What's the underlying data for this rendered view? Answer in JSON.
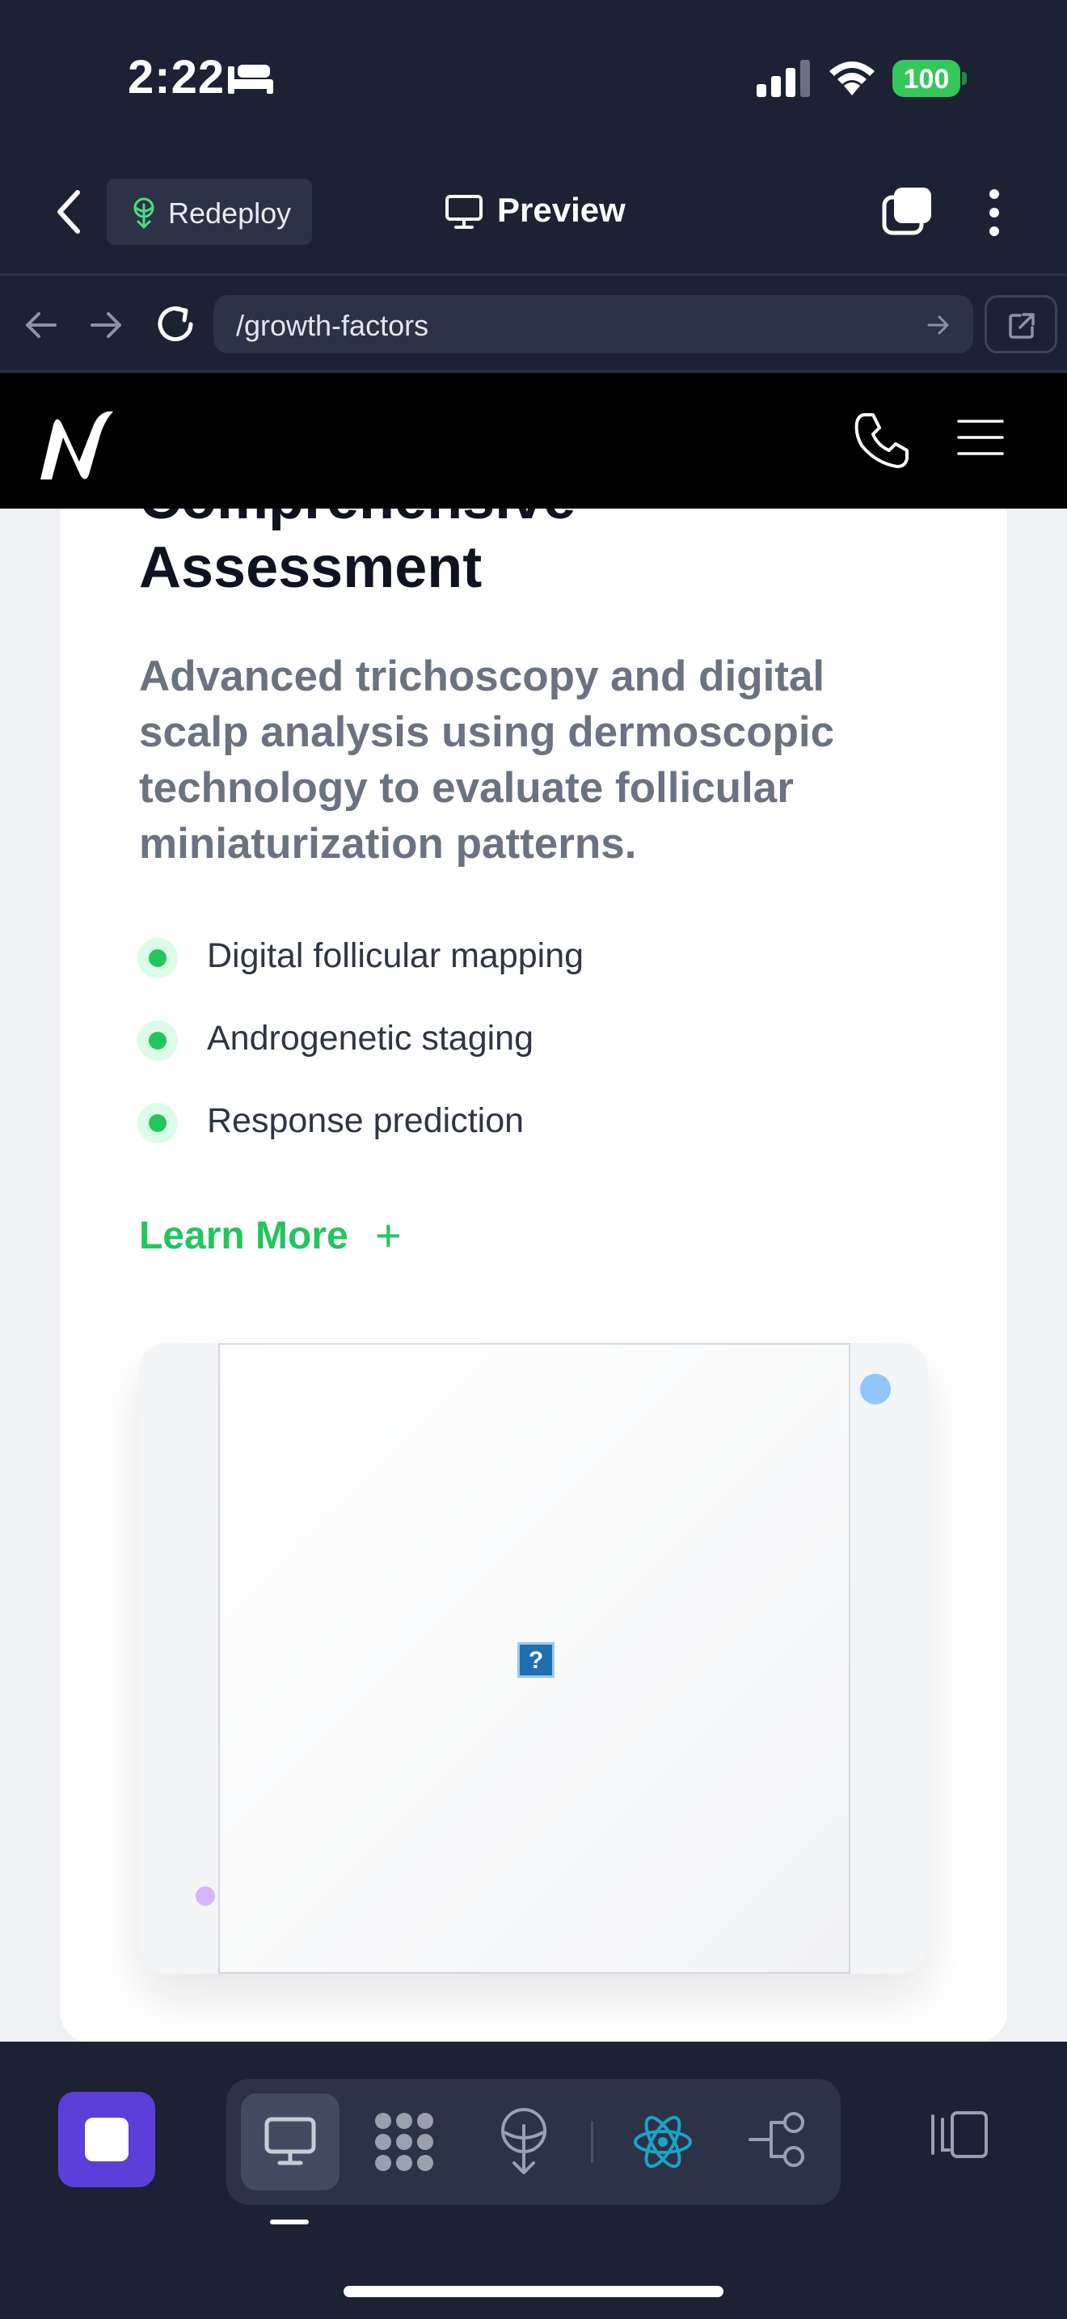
{
  "status_bar": {
    "time": "2:22",
    "battery": "100",
    "icons": [
      "bed-icon",
      "signal-icon",
      "wifi-icon",
      "battery-icon"
    ]
  },
  "app_header": {
    "redeploy_label": "Redeploy",
    "title": "Preview",
    "icons": [
      "back-icon",
      "redeploy-icon",
      "desktop-icon",
      "tabs-icon",
      "more-icon"
    ]
  },
  "url_bar": {
    "url": "/growth-factors",
    "icons": [
      "nav-back-icon",
      "nav-forward-icon",
      "reload-icon",
      "arrow-right-icon",
      "open-external-icon"
    ]
  },
  "page": {
    "heading_line1": "Comprehensive",
    "heading_line2": "Assessment",
    "description": "Advanced trichoscopy and digital scalp analysis using dermoscopic technology to evaluate follicular miniaturization patterns.",
    "features": [
      {
        "label": "Digital follicular mapping"
      },
      {
        "label": "Androgenetic staging"
      },
      {
        "label": "Response prediction"
      }
    ],
    "learn_more_label": "Learn More",
    "learn_more_symbol": "+",
    "broken_image_glyph": "?",
    "accent_color": "#22c55e"
  },
  "site_header": {
    "icons": [
      "logo-icon",
      "phone-icon",
      "menu-icon"
    ]
  },
  "toolbar": {
    "modes": [
      "desktop-icon",
      "grid-icon",
      "deploy-icon",
      "react-icon",
      "flow-icon"
    ],
    "active_mode": "desktop",
    "icons": [
      "stop-icon",
      "split-view-icon"
    ],
    "accent_color": "#5b3fd8"
  }
}
